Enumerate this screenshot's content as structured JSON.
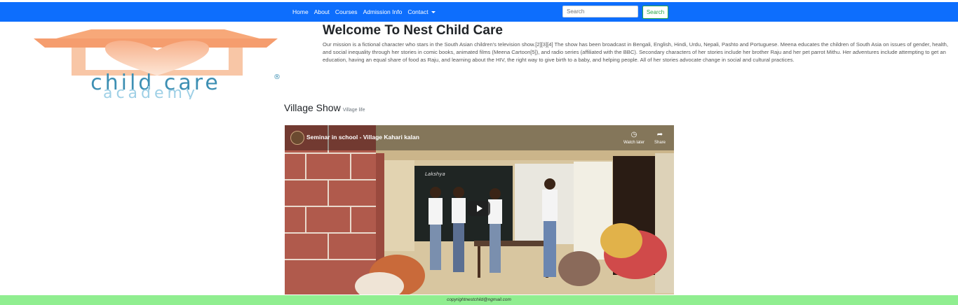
{
  "nav": {
    "items": [
      {
        "label": "Home"
      },
      {
        "label": "About"
      },
      {
        "label": "Courses"
      },
      {
        "label": "Admission Info"
      },
      {
        "label": "Contact"
      }
    ],
    "search_placeholder": "Search",
    "search_button": "Search"
  },
  "logo": {
    "line1": "child care",
    "line2": "academy",
    "mark": "®"
  },
  "welcome": {
    "title": "Welcome To Nest Child Care",
    "text": "Our mission is a fictional character who stars in the South Asian children's television show.[2][3][4] The show has been broadcast in Bengali, English, Hindi, Urdu, Nepali, Pashto and Portuguese. Meena educates the children of South Asia on issues of gender, health, and social inequality through her stories in comic books, animated films (Meena Cartoon[5]), and radio series (affiliated with the BBC). Secondary characters of her stories include her brother Raju and her pet parrot Mithu. Her adventures include attempting to get an education, having an equal share of food as Raju, and learning about the HIV, the right way to give birth to a baby, and helping people. All of her stories advocate change in social and cultural practices."
  },
  "section": {
    "title": "Village Show",
    "subtitle": "Village life"
  },
  "video": {
    "title": "Seminar in school - Village Kahari kalan",
    "watch_later": "Watch later",
    "share": "Share",
    "board_text": "Lakshya"
  },
  "colors": {
    "navbar": "#0d6efd",
    "footer": "#90ee90",
    "search_button": "#28a745",
    "logo_orange": "#f4a06a",
    "logo_blue": "#5aa7c8"
  },
  "footer": {
    "text": "copyrightnestchild@ngmail.com"
  }
}
